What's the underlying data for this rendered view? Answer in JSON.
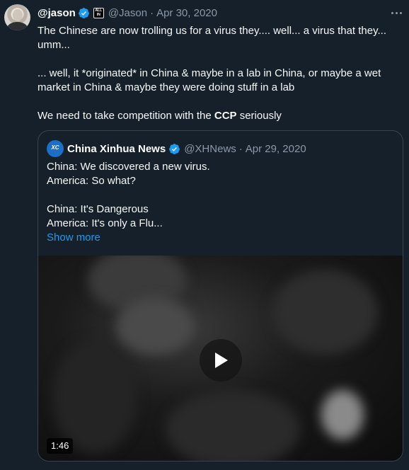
{
  "tweet": {
    "display_name": "@jason",
    "handle": "@Jason",
    "separator": "·",
    "date": "Apr 30, 2020",
    "affiliate_badge_lines": [
      "ALL",
      "IN"
    ],
    "body": {
      "line1": "The Chinese are now trolling us for a virus they.... well...  a virus that they...",
      "line2": "umm...",
      "line3": "... well, it *originated* in China & maybe in a lab in China, or maybe a wet",
      "line4": "market in China & maybe they were doing stuff in a lab",
      "line5_prefix": "We need to take competition with the ",
      "line5_bold": "CCP",
      "line5_suffix": " seriously"
    }
  },
  "quote": {
    "display_name": "China Xinhua News",
    "handle": "@XHNews",
    "separator": "·",
    "date": "Apr 29, 2020",
    "avatar_text": "XC",
    "lines": [
      "China: We discovered a new virus.",
      "America: So what?",
      "China: It's Dangerous",
      "America: It's only a Flu..."
    ],
    "show_more": "Show more",
    "video": {
      "duration": "1:46"
    }
  },
  "colors": {
    "background": "#15202b",
    "accent": "#1d9bf0",
    "muted": "#8b98a5",
    "border": "#38444d"
  }
}
